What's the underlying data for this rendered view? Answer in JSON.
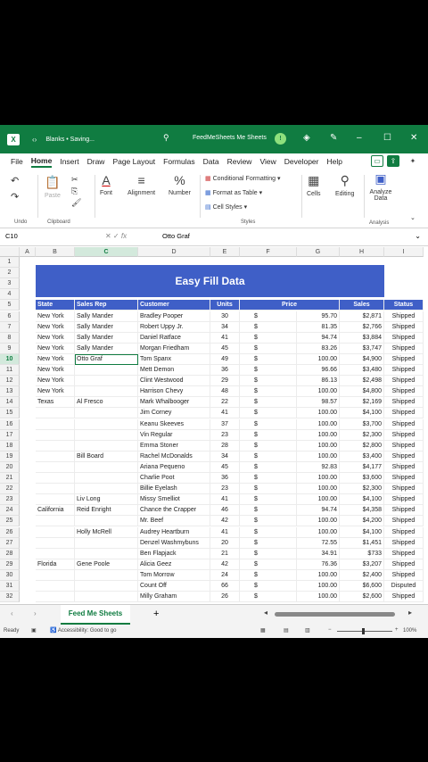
{
  "titlebar": {
    "doc_status": "Blanks • Saving...",
    "app_title": "FeedMeSheets Me Sheets",
    "logo_text": "X"
  },
  "menu": [
    "File",
    "Home",
    "Insert",
    "Draw",
    "Page Layout",
    "Formulas",
    "Data",
    "Review",
    "View",
    "Developer",
    "Help"
  ],
  "ribbon": {
    "undo_label": "Undo",
    "paste_label": "Paste",
    "clipboard_label": "Clipboard",
    "font_label": "Font",
    "alignment_label": "Alignment",
    "number_label": "Number",
    "cond_format": "Conditional Formatting",
    "format_table": "Format as Table",
    "cell_styles": "Cell Styles",
    "styles_label": "Styles",
    "cells_label": "Cells",
    "editing_label": "Editing",
    "analyze_label": "Analyze Data",
    "analysis_label": "Analysis"
  },
  "formula_bar": {
    "name_box": "C10",
    "fx": "fx",
    "formula": "Otto Graf"
  },
  "columns": [
    "A",
    "B",
    "C",
    "D",
    "E",
    "F",
    "G",
    "H",
    "I"
  ],
  "banner": "Easy Fill Data",
  "table_headers": [
    "State",
    "Sales Rep",
    "Customer",
    "Units",
    "Price",
    "Sales",
    "Status"
  ],
  "rows": [
    [
      "New York",
      "Sally Mander",
      "Bradley Pooper",
      "30",
      "$",
      "95.70",
      "$2,871",
      "Shipped"
    ],
    [
      "New York",
      "Sally Mander",
      "Robert Uppy Jr.",
      "34",
      "$",
      "81.35",
      "$2,766",
      "Shipped"
    ],
    [
      "New York",
      "Sally Mander",
      "Daniel Ratface",
      "41",
      "$",
      "94.74",
      "$3,884",
      "Shipped"
    ],
    [
      "New York",
      "Sally Mander",
      "Morgan Friedham",
      "45",
      "$",
      "83.26",
      "$3,747",
      "Shipped"
    ],
    [
      "New York",
      "Otto Graf",
      "Tom Spanx",
      "49",
      "$",
      "100.00",
      "$4,900",
      "Shipped"
    ],
    [
      "New York",
      "",
      "Mett Demon",
      "36",
      "$",
      "96.66",
      "$3,480",
      "Shipped"
    ],
    [
      "New York",
      "",
      "Clint Westwood",
      "29",
      "$",
      "86.13",
      "$2,498",
      "Shipped"
    ],
    [
      "New York",
      "",
      "Harrison Chevy",
      "48",
      "$",
      "100.00",
      "$4,800",
      "Shipped"
    ],
    [
      "Texas",
      "Al Fresco",
      "Mark Whalbooger",
      "22",
      "$",
      "98.57",
      "$2,169",
      "Shipped"
    ],
    [
      "",
      "",
      "Jim Corney",
      "41",
      "$",
      "100.00",
      "$4,100",
      "Shipped"
    ],
    [
      "",
      "",
      "Keanu Skeeves",
      "37",
      "$",
      "100.00",
      "$3,700",
      "Shipped"
    ],
    [
      "",
      "",
      "Vin Regular",
      "23",
      "$",
      "100.00",
      "$2,300",
      "Shipped"
    ],
    [
      "",
      "",
      "Emma Stoner",
      "28",
      "$",
      "100.00",
      "$2,800",
      "Shipped"
    ],
    [
      "",
      "Bill Board",
      "Rachel McDonalds",
      "34",
      "$",
      "100.00",
      "$3,400",
      "Shipped"
    ],
    [
      "",
      "",
      "Ariana Pequeno",
      "45",
      "$",
      "92.83",
      "$4,177",
      "Shipped"
    ],
    [
      "",
      "",
      "Charlie Poot",
      "36",
      "$",
      "100.00",
      "$3,600",
      "Shipped"
    ],
    [
      "",
      "",
      "Billie Eyelash",
      "23",
      "$",
      "100.00",
      "$2,300",
      "Shipped"
    ],
    [
      "",
      "Liv Long",
      "Missy Smelliot",
      "41",
      "$",
      "100.00",
      "$4,100",
      "Shipped"
    ],
    [
      "California",
      "Reid Enright",
      "Chance the Crapper",
      "46",
      "$",
      "94.74",
      "$4,358",
      "Shipped"
    ],
    [
      "",
      "",
      "Mr. Beef",
      "42",
      "$",
      "100.00",
      "$4,200",
      "Shipped"
    ],
    [
      "",
      "Holly McRell",
      "Audrey Heartburn",
      "41",
      "$",
      "100.00",
      "$4,100",
      "Shipped"
    ],
    [
      "",
      "",
      "Denzel Washmybuns",
      "20",
      "$",
      "72.55",
      "$1,451",
      "Shipped"
    ],
    [
      "",
      "",
      "Ben Flapjack",
      "21",
      "$",
      "34.91",
      "$733",
      "Shipped"
    ],
    [
      "Florida",
      "Gene Poole",
      "Alicia Geez",
      "42",
      "$",
      "76.36",
      "$3,207",
      "Shipped"
    ],
    [
      "",
      "",
      "Tom Morrow",
      "24",
      "$",
      "100.00",
      "$2,400",
      "Shipped"
    ],
    [
      "",
      "",
      "Count Off",
      "66",
      "$",
      "100.00",
      "$6,600",
      "Disputed"
    ],
    [
      "",
      "",
      "Milly Graham",
      "26",
      "$",
      "100.00",
      "$2,600",
      "Shipped"
    ]
  ],
  "sheet_tab": "Feed Me Sheets",
  "status": {
    "ready": "Ready",
    "accessibility": "Accessibility: Good to go",
    "zoom": "100%"
  },
  "colors": {
    "excel_green": "#107c41",
    "header_blue": "#3f5fc7"
  }
}
